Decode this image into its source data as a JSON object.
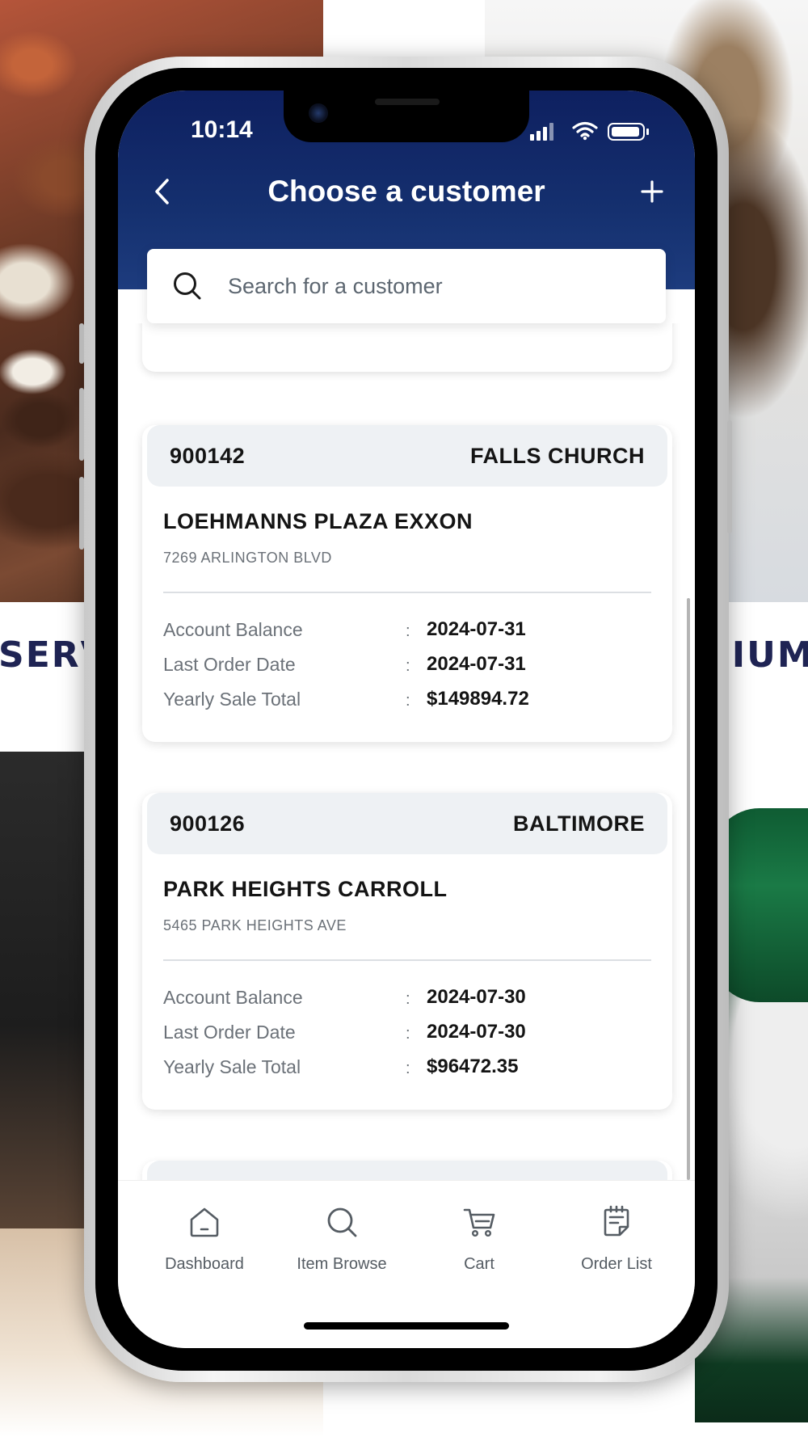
{
  "background": {
    "left_text": "SERVI",
    "right_text": "MIUM"
  },
  "status_bar": {
    "time": "10:14"
  },
  "header": {
    "title": "Choose a customer",
    "back_icon": "chevron-left-icon",
    "add_icon": "plus-icon"
  },
  "search": {
    "placeholder": "Search for a customer",
    "value": "",
    "icon": "search-icon"
  },
  "customers": [
    {
      "id": "900142",
      "city": "FALLS CHURCH",
      "name": "LOEHMANNS PLAZA EXXON",
      "address": "7269 ARLINGTON BLVD",
      "fields": [
        {
          "label": "Account Balance",
          "sep": ":",
          "value": "2024-07-31"
        },
        {
          "label": "Last Order Date",
          "sep": ":",
          "value": "2024-07-31"
        },
        {
          "label": "Yearly Sale Total",
          "sep": ":",
          "value": "$149894.72"
        }
      ]
    },
    {
      "id": "900126",
      "city": "BALTIMORE",
      "name": "PARK HEIGHTS CARROLL",
      "address": "5465 PARK HEIGHTS AVE",
      "fields": [
        {
          "label": "Account Balance",
          "sep": ":",
          "value": "2024-07-30"
        },
        {
          "label": "Last Order Date",
          "sep": ":",
          "value": "2024-07-30"
        },
        {
          "label": "Yearly Sale Total",
          "sep": ":",
          "value": "$96472.35"
        }
      ]
    }
  ],
  "tabbar": {
    "items": [
      {
        "label": "Dashboard",
        "icon": "home-icon"
      },
      {
        "label": "Item Browse",
        "icon": "search-icon"
      },
      {
        "label": "Cart",
        "icon": "cart-icon"
      },
      {
        "label": "Order List",
        "icon": "order-list-icon"
      }
    ]
  },
  "colors": {
    "header_top": "#0e2060",
    "header_bottom": "#1d3c7e",
    "card_header_bg": "#eef1f4",
    "text_primary": "#141414",
    "text_secondary": "#6b7178"
  }
}
